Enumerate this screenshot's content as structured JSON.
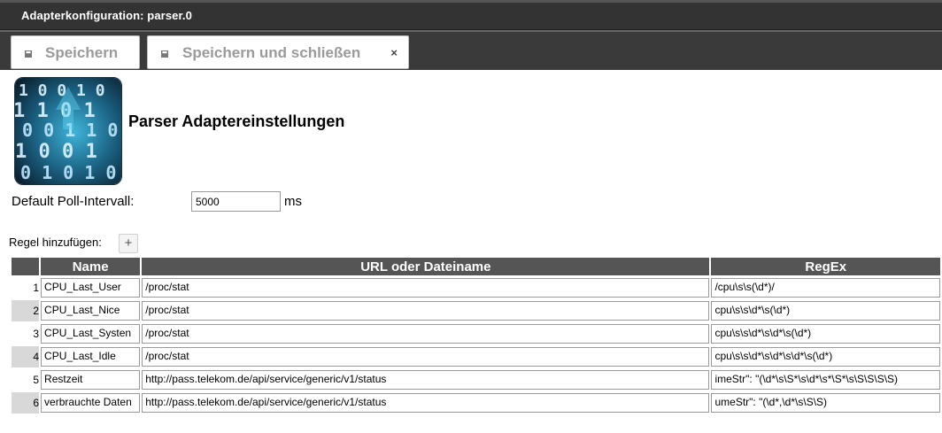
{
  "window": {
    "title": "Adapterkonfiguration: parser.0"
  },
  "toolbar": {
    "save_label": "Speichern",
    "save_close_label": "Speichern und schließen",
    "close_glyph": "×"
  },
  "settings": {
    "heading": "Parser Adaptereinstellungen",
    "poll_label": "Default Poll-Intervall:",
    "poll_value": "5000",
    "poll_unit": "ms"
  },
  "rules": {
    "add_label": "Regel hinzufügen:",
    "add_glyph": "+",
    "columns": {
      "name": "Name",
      "url": "URL oder Dateiname",
      "regex": "RegEx"
    },
    "rows": [
      {
        "num": "1",
        "name": "CPU_Last_User",
        "url": "/proc/stat",
        "regex": "/cpu\\s\\s(\\d*)/"
      },
      {
        "num": "2",
        "name": "CPU_Last_Nice",
        "url": "/proc/stat",
        "regex": "cpu\\s\\s\\d*\\s(\\d*)"
      },
      {
        "num": "3",
        "name": "CPU_Last_Systen",
        "url": "/proc/stat",
        "regex": "cpu\\s\\s\\d*\\s\\d*\\s(\\d*)"
      },
      {
        "num": "4",
        "name": "CPU_Last_Idle",
        "url": "/proc/stat",
        "regex": "cpu\\s\\s\\d*\\s\\d*\\s\\d*\\s(\\d*)"
      },
      {
        "num": "5",
        "name": "Restzeit",
        "url": "http://pass.telekom.de/api/service/generic/v1/status",
        "regex": "imeStr\": \"(\\d*\\s\\S*\\s\\d*\\s*\\S*\\s\\S\\S\\S\\S)"
      },
      {
        "num": "6",
        "name": "verbrauchte Daten",
        "url": "http://pass.telekom.de/api/service/generic/v1/status",
        "regex": "umeStr\": \"(\\d*,\\d*\\s\\S\\S)"
      }
    ]
  },
  "icons": {
    "save": "save-icon",
    "close": "close-icon",
    "add": "plus-icon",
    "logo": "binary-digits-logo"
  },
  "colors": {
    "titlebar": "#333333",
    "toolbar": "#3a3a3a",
    "table_header": "#555555",
    "alt_row": "#d8d8d8"
  }
}
